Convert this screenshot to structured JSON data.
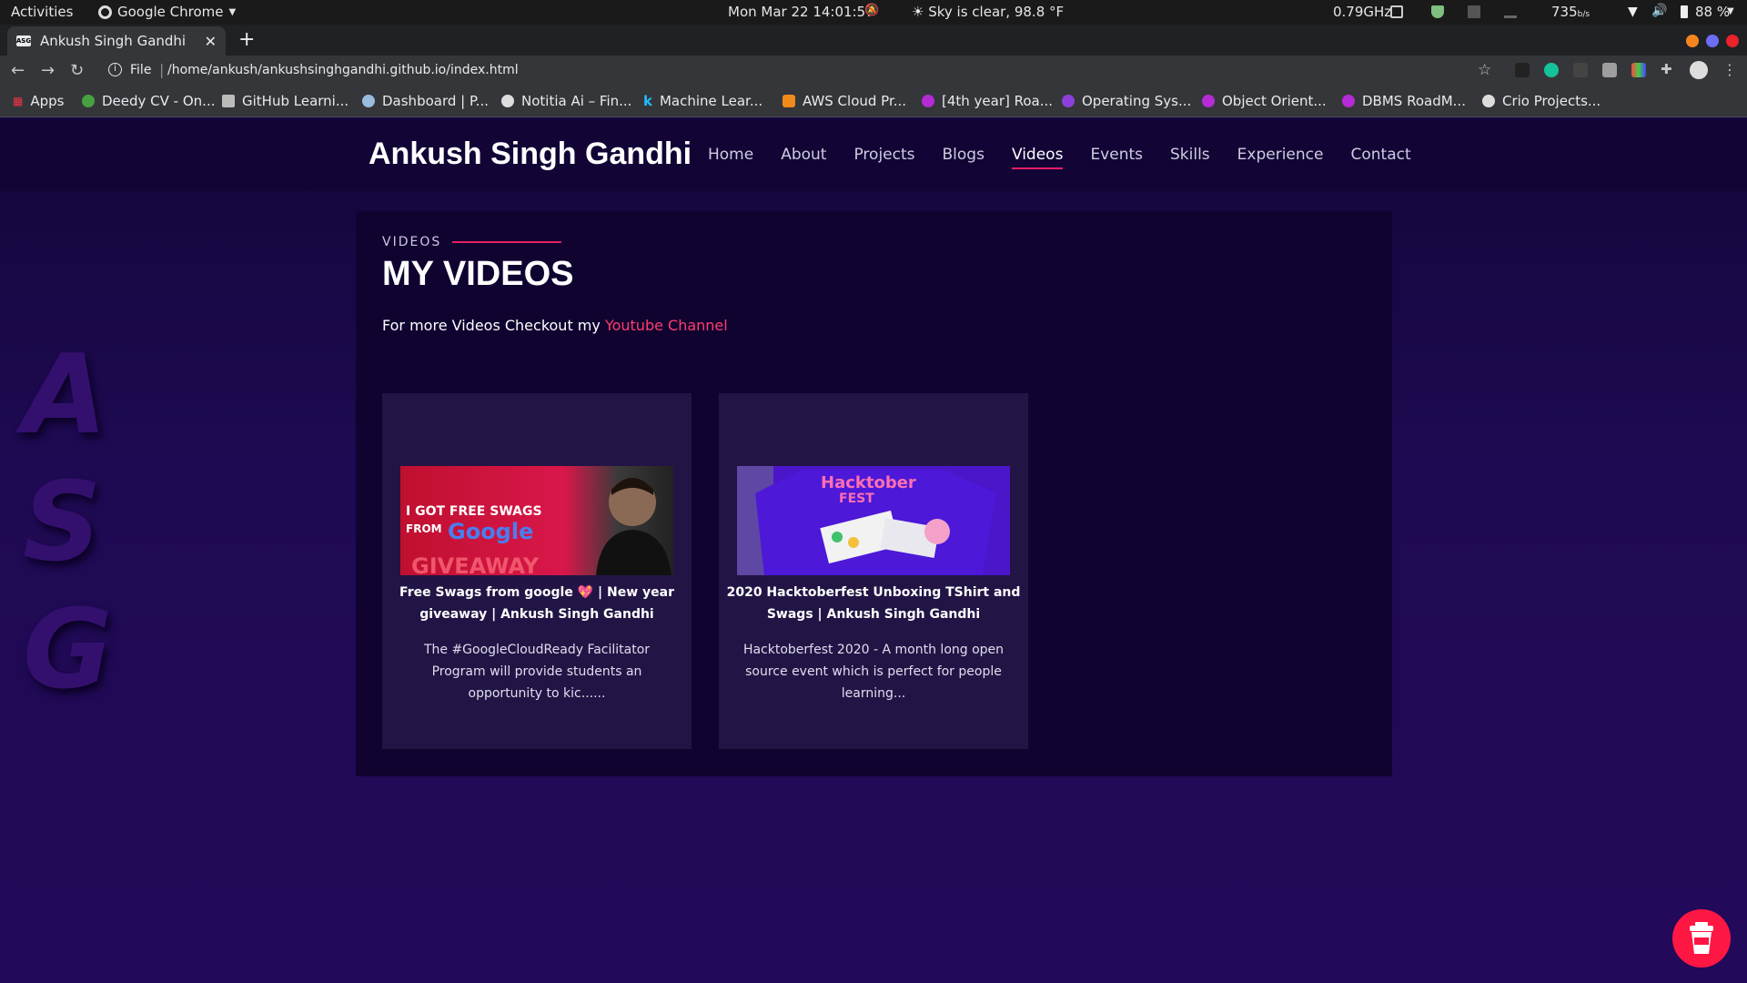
{
  "system_bar": {
    "activities": "Activities",
    "app": "Google Chrome",
    "clock": "Mon Mar 22  14:01:57",
    "weather": "Sky is clear, 98.8 °F",
    "cpu": "0.79GHz",
    "net_speed": "735",
    "net_unit": "b/s",
    "battery": "88 %"
  },
  "browser": {
    "tab_title": "Ankush Singh Gandhi",
    "tab_favicon": "ASG",
    "address_scheme": "File",
    "address_url": "/home/ankush/ankushsinghgandhi.github.io/index.html",
    "bookmarks": [
      {
        "label": "Apps"
      },
      {
        "label": "Deedy CV - On..."
      },
      {
        "label": "GitHub Learni..."
      },
      {
        "label": "Dashboard | P..."
      },
      {
        "label": "Notitia Ai – Fin..."
      },
      {
        "label": "Machine Lear..."
      },
      {
        "label": "AWS Cloud Pr..."
      },
      {
        "label": "[4th year] Roa..."
      },
      {
        "label": "Operating Sys..."
      },
      {
        "label": "Object Orient..."
      },
      {
        "label": "DBMS RoadM..."
      },
      {
        "label": "Crio Projects..."
      }
    ]
  },
  "site": {
    "brand": "Ankush Singh Gandhi",
    "nav": [
      "Home",
      "About",
      "Projects",
      "Blogs",
      "Videos",
      "Events",
      "Skills",
      "Experience",
      "Contact"
    ],
    "active_nav": "Videos",
    "side_letters": [
      "A",
      "S",
      "G"
    ]
  },
  "videos_section": {
    "kicker": "VIDEOS",
    "title": "MY VIDEOS",
    "intro_text": "For more Videos Checkout my ",
    "intro_link": "Youtube Channel",
    "cards": [
      {
        "title": "Free Swags from google 💖 | New year giveaway | Ankush Singh Gandhi",
        "description": "The #GoogleCloudReady Facilitator Program will provide students an opportunity to kic......",
        "thumb_line1": "I GOT FREE SWAGS",
        "thumb_line2": "FROM",
        "thumb_brand": "Google",
        "thumb_line3": "GIVEAWAY"
      },
      {
        "title": "2020 Hacktoberfest Unboxing TShirt and Swags | Ankush Singh Gandhi",
        "description": "Hacktoberfest 2020 - A month long open source event which is perfect for people learning...",
        "thumb_line1": "Hacktober",
        "thumb_line2": "FEST"
      }
    ]
  },
  "colors": {
    "accent": "#e91e63",
    "link": "#ff3d6e",
    "page_bg": "#1c0a4a",
    "panel_bg": "#100330",
    "card_bg": "#221545"
  }
}
